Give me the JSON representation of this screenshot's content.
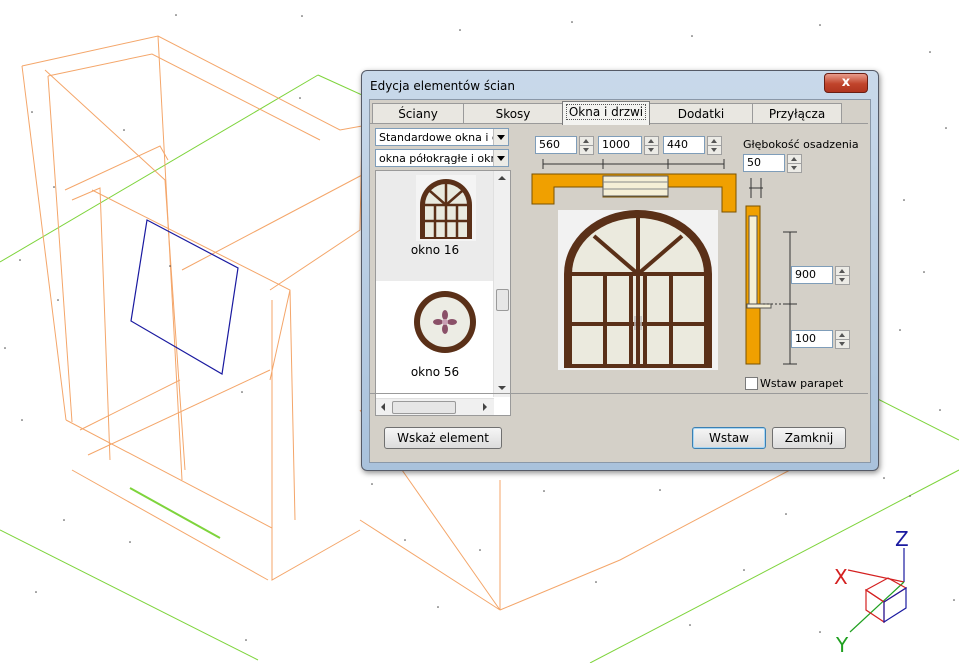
{
  "dialog": {
    "title": "Edycja elementów ścian",
    "close_label": "x"
  },
  "tabs": [
    {
      "label": "Ściany"
    },
    {
      "label": "Skosy"
    },
    {
      "label": "Okna i drzwi"
    },
    {
      "label": "Dodatki"
    },
    {
      "label": "Przyłącza"
    }
  ],
  "active_tab": "Okna i drzwi",
  "filters": {
    "category_value": "Standardowe okna i drz",
    "subcategory_value": "okna półokrągłe i okrą"
  },
  "catalog": [
    {
      "label": "okno 16",
      "selected": true
    },
    {
      "label": "okno 56",
      "selected": false
    }
  ],
  "dimensions": {
    "width": "560",
    "height": "1000",
    "depth": "440",
    "mount_depth_label": "Głębokość osadzenia",
    "mount_depth": "50",
    "window_height": "900",
    "sill_height": "100"
  },
  "parapet": {
    "label": "Wstaw parapet",
    "checked": false
  },
  "buttons": {
    "pick_element": "Wskaż element",
    "insert": "Wstaw",
    "close": "Zamknij"
  },
  "axes": {
    "x": "X",
    "y": "Y",
    "z": "Z"
  },
  "colors": {
    "frame_orange": "#f0a000",
    "wood": "#5a3018",
    "cad_orange": "#f4a66a",
    "cad_green": "#7ed43c",
    "cad_blue": "#1a1aa0"
  }
}
